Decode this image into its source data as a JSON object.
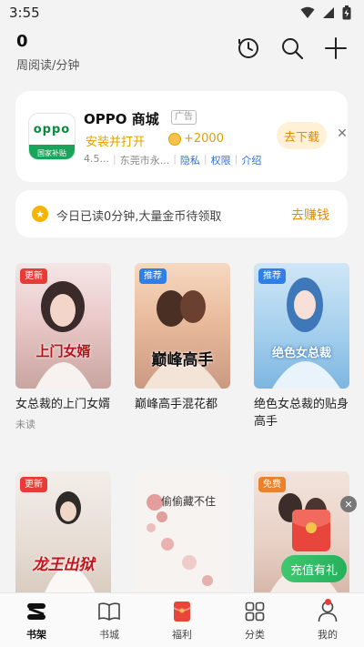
{
  "status_bar": {
    "time": "3:55"
  },
  "header": {
    "read_count": "0",
    "read_label": "周阅读/分钟"
  },
  "ad": {
    "logo_text": "oppo",
    "logo_sub": "国家补贴",
    "name": "OPPO 商城",
    "tag": "广告",
    "install_text": "安装并打开",
    "coins": "+2000",
    "rating": "4.5...",
    "developer": "东莞市永...",
    "privacy": "隐私",
    "permissions": "权限",
    "intro": "介绍",
    "download": "去下载"
  },
  "task": {
    "text": "今日已读0分钟,大量金币待领取",
    "earn": "去赚钱"
  },
  "books": [
    {
      "title": "女总裁的上门女婿",
      "badge": "更新",
      "cover_text": "上门女婿",
      "status": "未读"
    },
    {
      "title": "巅峰高手混花都",
      "badge": "推荐",
      "cover_text": "巅峰高手"
    },
    {
      "title": "绝色女总裁的贴身高手",
      "badge": "推荐",
      "cover_text": "绝色女总裁"
    },
    {
      "title": "",
      "badge": "更新",
      "cover_text": "龙王出狱"
    },
    {
      "title": "",
      "badge": "",
      "cover_text": "偷偷藏不住"
    },
    {
      "title": "",
      "badge": "免费",
      "cover_text": ""
    }
  ],
  "recharge": "充值有礼",
  "tabs": [
    {
      "label": "书架",
      "icon": "bookshelf-icon"
    },
    {
      "label": "书城",
      "icon": "book-open-icon"
    },
    {
      "label": "福利",
      "icon": "gift-icon"
    },
    {
      "label": "分类",
      "icon": "grid-icon"
    },
    {
      "label": "我的",
      "icon": "person-icon"
    }
  ]
}
